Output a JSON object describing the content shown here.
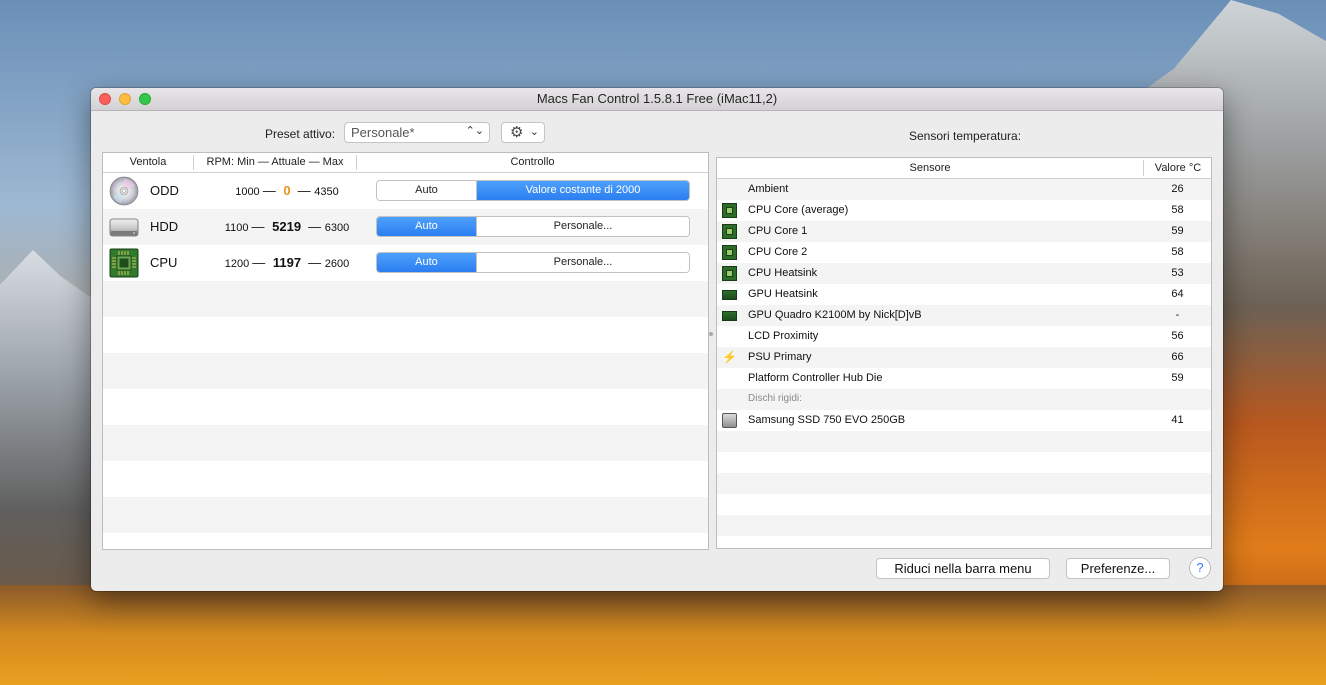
{
  "window": {
    "title": "Macs Fan Control 1.5.8.1 Free (iMac11,2)"
  },
  "toolbar": {
    "preset_label": "Preset attivo:",
    "preset_value": "Personale*",
    "gear_icon": "gear-icon",
    "sensors_label": "Sensori temperatura:"
  },
  "fans_table": {
    "columns": [
      "Ventola",
      "RPM: Min — Attuale — Max",
      "Controllo"
    ],
    "rows": [
      {
        "name": "ODD",
        "icon": "optical-disc-icon",
        "min": "1000",
        "current": "0",
        "max": "4350",
        "control_auto": "Auto",
        "control_custom": "Valore costante di 2000",
        "active": "custom",
        "current_color": "#ef8f1c"
      },
      {
        "name": "HDD",
        "icon": "hard-drive-icon",
        "min": "1100",
        "current": "5219",
        "max": "6300",
        "control_auto": "Auto",
        "control_custom": "Personale...",
        "active": "auto"
      },
      {
        "name": "CPU",
        "icon": "cpu-chip-icon",
        "min": "1200",
        "current": "1197",
        "max": "2600",
        "control_auto": "Auto",
        "control_custom": "Personale...",
        "active": "auto"
      }
    ]
  },
  "sensors_table": {
    "columns": [
      "Sensore",
      "Valore °C"
    ],
    "rows": [
      {
        "name": "Ambient",
        "value": "26",
        "icon": ""
      },
      {
        "name": "CPU Core (average)",
        "value": "58",
        "icon": "cpu-chip-icon"
      },
      {
        "name": "CPU Core 1",
        "value": "59",
        "icon": "cpu-chip-icon"
      },
      {
        "name": "CPU Core 2",
        "value": "58",
        "icon": "cpu-chip-icon"
      },
      {
        "name": "CPU Heatsink",
        "value": "53",
        "icon": "cpu-chip-icon"
      },
      {
        "name": "GPU Heatsink",
        "value": "64",
        "icon": "gpu-card-icon"
      },
      {
        "name": "GPU Quadro K2100M by Nick[D]vB",
        "value": "-",
        "icon": "gpu-card-icon"
      },
      {
        "name": "LCD Proximity",
        "value": "56",
        "icon": ""
      },
      {
        "name": "PSU Primary",
        "value": "66",
        "icon": "lightning-bolt-icon"
      },
      {
        "name": "Platform Controller Hub Die",
        "value": "59",
        "icon": ""
      }
    ],
    "section_label": "Dischi rigidi:",
    "disk_rows": [
      {
        "name": "Samsung SSD 750 EVO 250GB",
        "value": "41",
        "icon": "drive-icon"
      }
    ]
  },
  "footer": {
    "minimize_label": "Riduci nella barra menu",
    "preferences_label": "Preferenze...",
    "help_label": "?"
  },
  "colors": {
    "accent": "#2b7ef1",
    "current_rpm_zero": "#ef8f1c"
  }
}
